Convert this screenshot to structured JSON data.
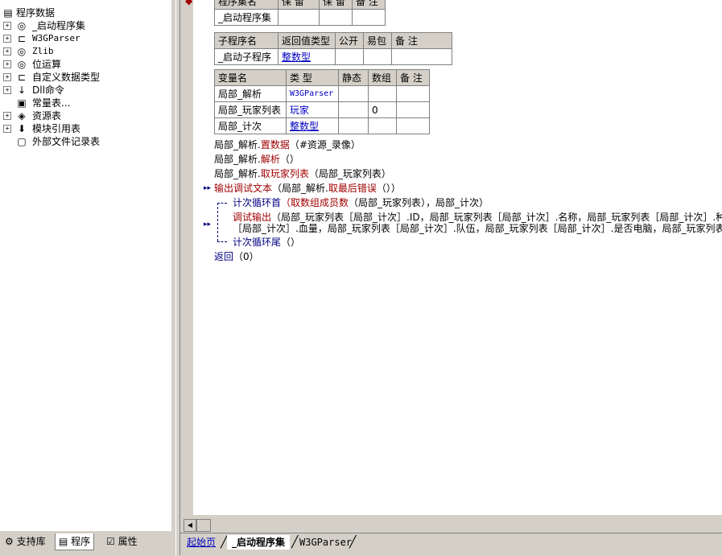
{
  "tree": {
    "root": "程序数据",
    "items": [
      {
        "label": "_启动程序集",
        "icon": "package-icon",
        "mono": false
      },
      {
        "label": "W3GParser",
        "icon": "class-icon",
        "mono": true
      },
      {
        "label": "Zlib",
        "icon": "package-icon",
        "mono": true
      },
      {
        "label": "位运算",
        "icon": "package-icon",
        "mono": false
      },
      {
        "label": "自定义数据类型",
        "icon": "class-icon",
        "mono": false
      },
      {
        "label": "Dll命令",
        "icon": "dll-icon",
        "mono": false
      },
      {
        "label": "常量表...",
        "icon": "constant-icon",
        "mono": false
      },
      {
        "label": "资源表",
        "icon": "resource-icon",
        "mono": false
      },
      {
        "label": "模块引用表",
        "icon": "module-icon",
        "mono": false
      },
      {
        "label": "外部文件记录表",
        "icon": "file-icon",
        "mono": false
      }
    ]
  },
  "left_tabs": [
    "支持库",
    "程序",
    "属性"
  ],
  "assembly_table": {
    "headers": [
      "程序集名",
      "保 留",
      "保 留",
      "备 注"
    ],
    "row": [
      "_启动程序集",
      "",
      "",
      ""
    ]
  },
  "sub_table": {
    "headers": [
      "子程序名",
      "返回值类型",
      "公开",
      "易包",
      "备 注"
    ],
    "row": [
      "_启动子程序",
      "整数型",
      "",
      "",
      ""
    ]
  },
  "var_table": {
    "headers": [
      "变量名",
      "类 型",
      "静态",
      "数组",
      "备 注"
    ],
    "rows": [
      [
        "局部_解析",
        "W3GParser",
        "",
        "",
        ""
      ],
      [
        "局部_玩家列表",
        "玩家",
        "",
        "0",
        ""
      ],
      [
        "局部_计次",
        "整数型",
        "",
        "",
        ""
      ]
    ]
  },
  "code": {
    "line1_obj": "局部_解析.",
    "line1_fn": "置数据",
    "line1_args": "（#资源_录像）",
    "line2_obj": "局部_解析.",
    "line2_fn": "解析",
    "line2_args": "（）",
    "line3_obj": "局部_解析.",
    "line3_fn": "取玩家列表",
    "line3_args": "（局部_玩家列表）",
    "line4_fn": "输出调试文本",
    "line4_a": "（局部_解析.",
    "line4_b": "取最后错误",
    "line4_c": "（））",
    "line5_kw": "计次循环首",
    "line5_fn": "（取数组成员数",
    "line5_args": "（局部_玩家列表），局部_计次）",
    "line6_fn": "调试输出",
    "line6_args": "（局部_玩家列表［局部_计次］.ID，局部_玩家列表［局部_计次］.名称，局部_玩家列表［局部_计次］.种族",
    "line7": "［局部_计次］.血量，局部_玩家列表［局部_计次］.队伍，局部_玩家列表［局部_计次］.是否电脑，局部_玩家列表［",
    "line8_kw": "计次循环尾",
    "line8_args": "（）",
    "line9_kw": "返回",
    "line9_args": "（0）"
  },
  "doc_tabs": [
    "起始页",
    "_启动程序集",
    "W3GParser"
  ]
}
